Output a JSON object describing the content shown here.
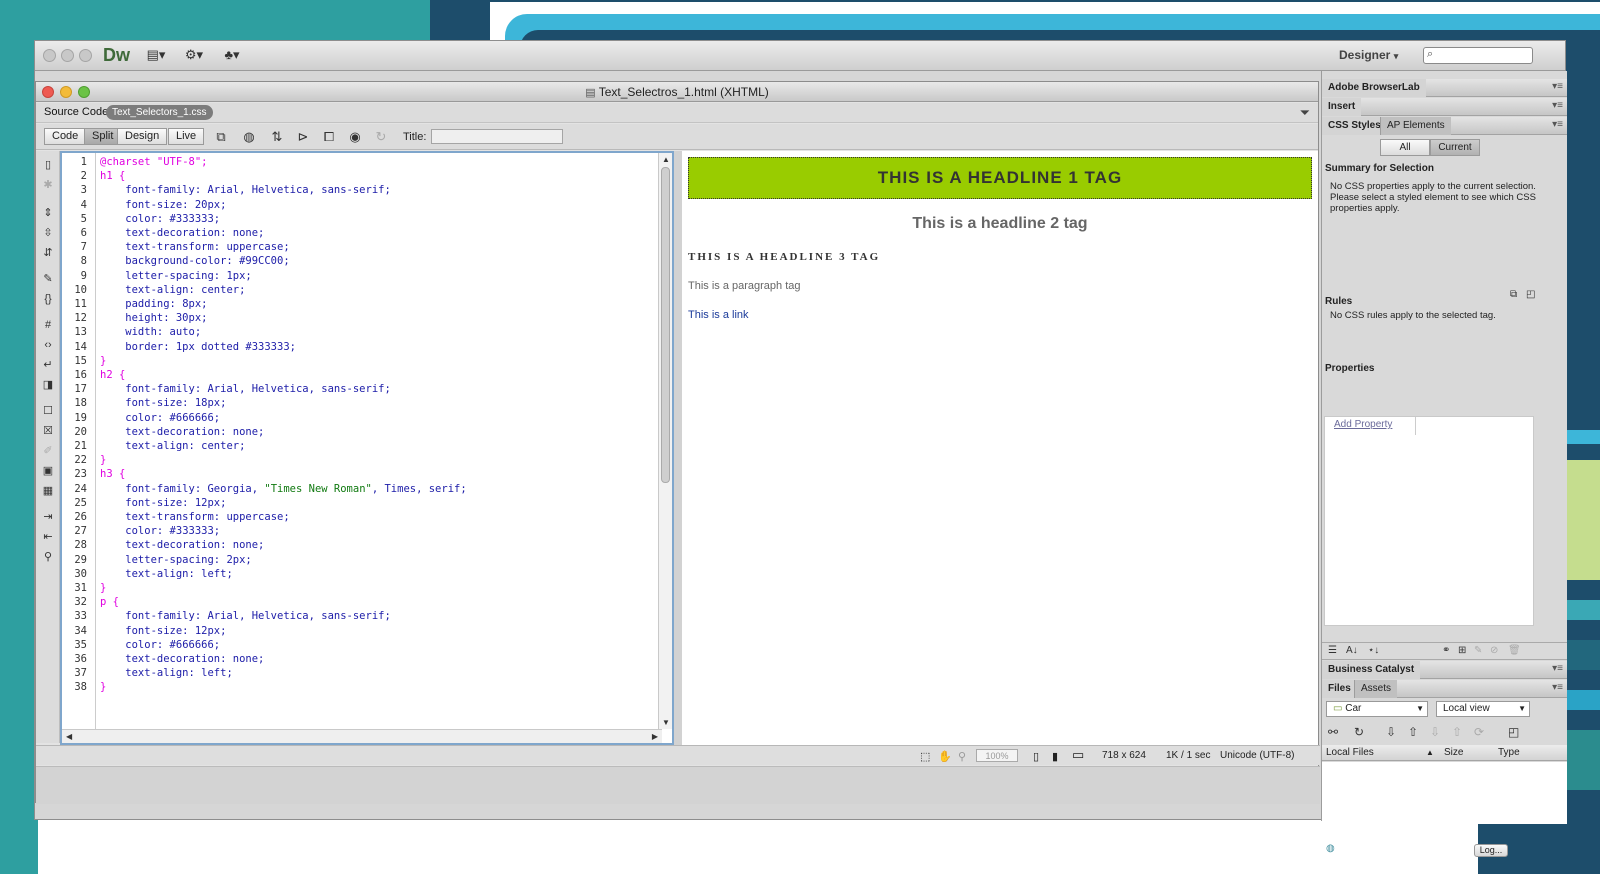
{
  "app": {
    "logo": "Dw",
    "workspace": "Designer",
    "workspace_caret": "▾"
  },
  "document": {
    "title": "Text_Selectros_1.html (XHTML)",
    "related_files": {
      "source_label": "Source Code",
      "css_file": "Text_Selectors_1.css"
    },
    "view_buttons": [
      "Code",
      "Split",
      "Design",
      "Live"
    ],
    "active_view": "Split",
    "title_label": "Title:",
    "title_value": ""
  },
  "code": {
    "line_numbers": [
      "1",
      "2",
      "3",
      "4",
      "5",
      "6",
      "7",
      "8",
      "9",
      "10",
      "11",
      "12",
      "13",
      "14",
      "15",
      "16",
      "17",
      "18",
      "19",
      "20",
      "21",
      "22",
      "23",
      "24",
      "25",
      "26",
      "27",
      "28",
      "29",
      "30",
      "31",
      "32",
      "33",
      "34",
      "35",
      "36",
      "37",
      "38"
    ],
    "lines": [
      [
        {
          "t": "@charset ",
          "c": "sel"
        },
        {
          "t": "\"UTF-8\";",
          "c": "sel"
        }
      ],
      [
        {
          "t": "h1 {",
          "c": "sel"
        }
      ],
      [
        {
          "t": "    font-family: ",
          "c": "prop"
        },
        {
          "t": "Arial, Helvetica, sans-serif;",
          "c": "val"
        }
      ],
      [
        {
          "t": "    font-size: ",
          "c": "prop"
        },
        {
          "t": "20px;",
          "c": "val"
        }
      ],
      [
        {
          "t": "    color: ",
          "c": "prop"
        },
        {
          "t": "#333333;",
          "c": "val"
        }
      ],
      [
        {
          "t": "    text-decoration: ",
          "c": "prop"
        },
        {
          "t": "none;",
          "c": "val"
        }
      ],
      [
        {
          "t": "    text-transform: ",
          "c": "prop"
        },
        {
          "t": "uppercase;",
          "c": "val"
        }
      ],
      [
        {
          "t": "    background-color: ",
          "c": "prop"
        },
        {
          "t": "#99CC00;",
          "c": "val"
        }
      ],
      [
        {
          "t": "    letter-spacing: ",
          "c": "prop"
        },
        {
          "t": "1px;",
          "c": "val"
        }
      ],
      [
        {
          "t": "    text-align: ",
          "c": "prop"
        },
        {
          "t": "center;",
          "c": "val"
        }
      ],
      [
        {
          "t": "    padding: ",
          "c": "prop"
        },
        {
          "t": "8px;",
          "c": "val"
        }
      ],
      [
        {
          "t": "    height: ",
          "c": "prop"
        },
        {
          "t": "30px;",
          "c": "val"
        }
      ],
      [
        {
          "t": "    width: ",
          "c": "prop"
        },
        {
          "t": "auto;",
          "c": "val"
        }
      ],
      [
        {
          "t": "    border: ",
          "c": "prop"
        },
        {
          "t": "1px dotted #333333;",
          "c": "val"
        }
      ],
      [
        {
          "t": "}",
          "c": "sel"
        }
      ],
      [
        {
          "t": "h2 {",
          "c": "sel"
        }
      ],
      [
        {
          "t": "    font-family: ",
          "c": "prop"
        },
        {
          "t": "Arial, Helvetica, sans-serif;",
          "c": "val"
        }
      ],
      [
        {
          "t": "    font-size: ",
          "c": "prop"
        },
        {
          "t": "18px;",
          "c": "val"
        }
      ],
      [
        {
          "t": "    color: ",
          "c": "prop"
        },
        {
          "t": "#666666;",
          "c": "val"
        }
      ],
      [
        {
          "t": "    text-decoration: ",
          "c": "prop"
        },
        {
          "t": "none;",
          "c": "val"
        }
      ],
      [
        {
          "t": "    text-align: ",
          "c": "prop"
        },
        {
          "t": "center;",
          "c": "val"
        }
      ],
      [
        {
          "t": "}",
          "c": "sel"
        }
      ],
      [
        {
          "t": "h3 {",
          "c": "sel"
        }
      ],
      [
        {
          "t": "    font-family: ",
          "c": "prop"
        },
        {
          "t": "Georgia, ",
          "c": "val"
        },
        {
          "t": "\"Times New Roman\"",
          "c": "str"
        },
        {
          "t": ", Times, serif;",
          "c": "val"
        }
      ],
      [
        {
          "t": "    font-size: ",
          "c": "prop"
        },
        {
          "t": "12px;",
          "c": "val"
        }
      ],
      [
        {
          "t": "    text-transform: ",
          "c": "prop"
        },
        {
          "t": "uppercase;",
          "c": "val"
        }
      ],
      [
        {
          "t": "    color: ",
          "c": "prop"
        },
        {
          "t": "#333333;",
          "c": "val"
        }
      ],
      [
        {
          "t": "    text-decoration: ",
          "c": "prop"
        },
        {
          "t": "none;",
          "c": "val"
        }
      ],
      [
        {
          "t": "    letter-spacing: ",
          "c": "prop"
        },
        {
          "t": "2px;",
          "c": "val"
        }
      ],
      [
        {
          "t": "    text-align: ",
          "c": "prop"
        },
        {
          "t": "left;",
          "c": "val"
        }
      ],
      [
        {
          "t": "}",
          "c": "sel"
        }
      ],
      [
        {
          "t": "p {",
          "c": "sel"
        }
      ],
      [
        {
          "t": "    font-family: ",
          "c": "prop"
        },
        {
          "t": "Arial, Helvetica, sans-serif;",
          "c": "val"
        }
      ],
      [
        {
          "t": "    font-size: ",
          "c": "prop"
        },
        {
          "t": "12px;",
          "c": "val"
        }
      ],
      [
        {
          "t": "    color: ",
          "c": "prop"
        },
        {
          "t": "#666666;",
          "c": "val"
        }
      ],
      [
        {
          "t": "    text-decoration: ",
          "c": "prop"
        },
        {
          "t": "none;",
          "c": "val"
        }
      ],
      [
        {
          "t": "    text-align: ",
          "c": "prop"
        },
        {
          "t": "left;",
          "c": "val"
        }
      ],
      [
        {
          "t": "}",
          "c": "sel"
        }
      ]
    ]
  },
  "design": {
    "h1": "THIS IS A HEADLINE 1 TAG",
    "h2": "This is a headline 2 tag",
    "h3": "THIS IS A HEADLINE 3 TAG",
    "p": "This is a paragraph tag",
    "link": "This is a link"
  },
  "status": {
    "zoom": "100%",
    "window_size": "718 x 624",
    "download": "1K / 1 sec",
    "encoding": "Unicode (UTF-8)"
  },
  "panels": {
    "browserlab": "Adobe BrowserLab",
    "insert": "Insert",
    "css_tabs": [
      "CSS Styles",
      "AP Elements"
    ],
    "mode_all": "All",
    "mode_current": "Current",
    "summary_title": "Summary for Selection",
    "summary_text": "No CSS properties apply to the current selection.  Please select a styled element to see which CSS properties apply.",
    "rules_title": "Rules",
    "rules_text": "No CSS rules apply to the selected tag.",
    "properties_title": "Properties",
    "add_property": "Add Property",
    "business_catalyst": "Business Catalyst",
    "files_tabs": [
      "Files",
      "Assets"
    ],
    "site": "Car",
    "view": "Local view",
    "files_columns": [
      "Local Files",
      "Size",
      "Type"
    ],
    "log_button": "Log..."
  },
  "colors": {
    "h1_bg": "#99CC00",
    "h1_text": "#333333",
    "h2_text": "#666666",
    "selector": "#e000e0",
    "property": "#1c1ca8"
  }
}
